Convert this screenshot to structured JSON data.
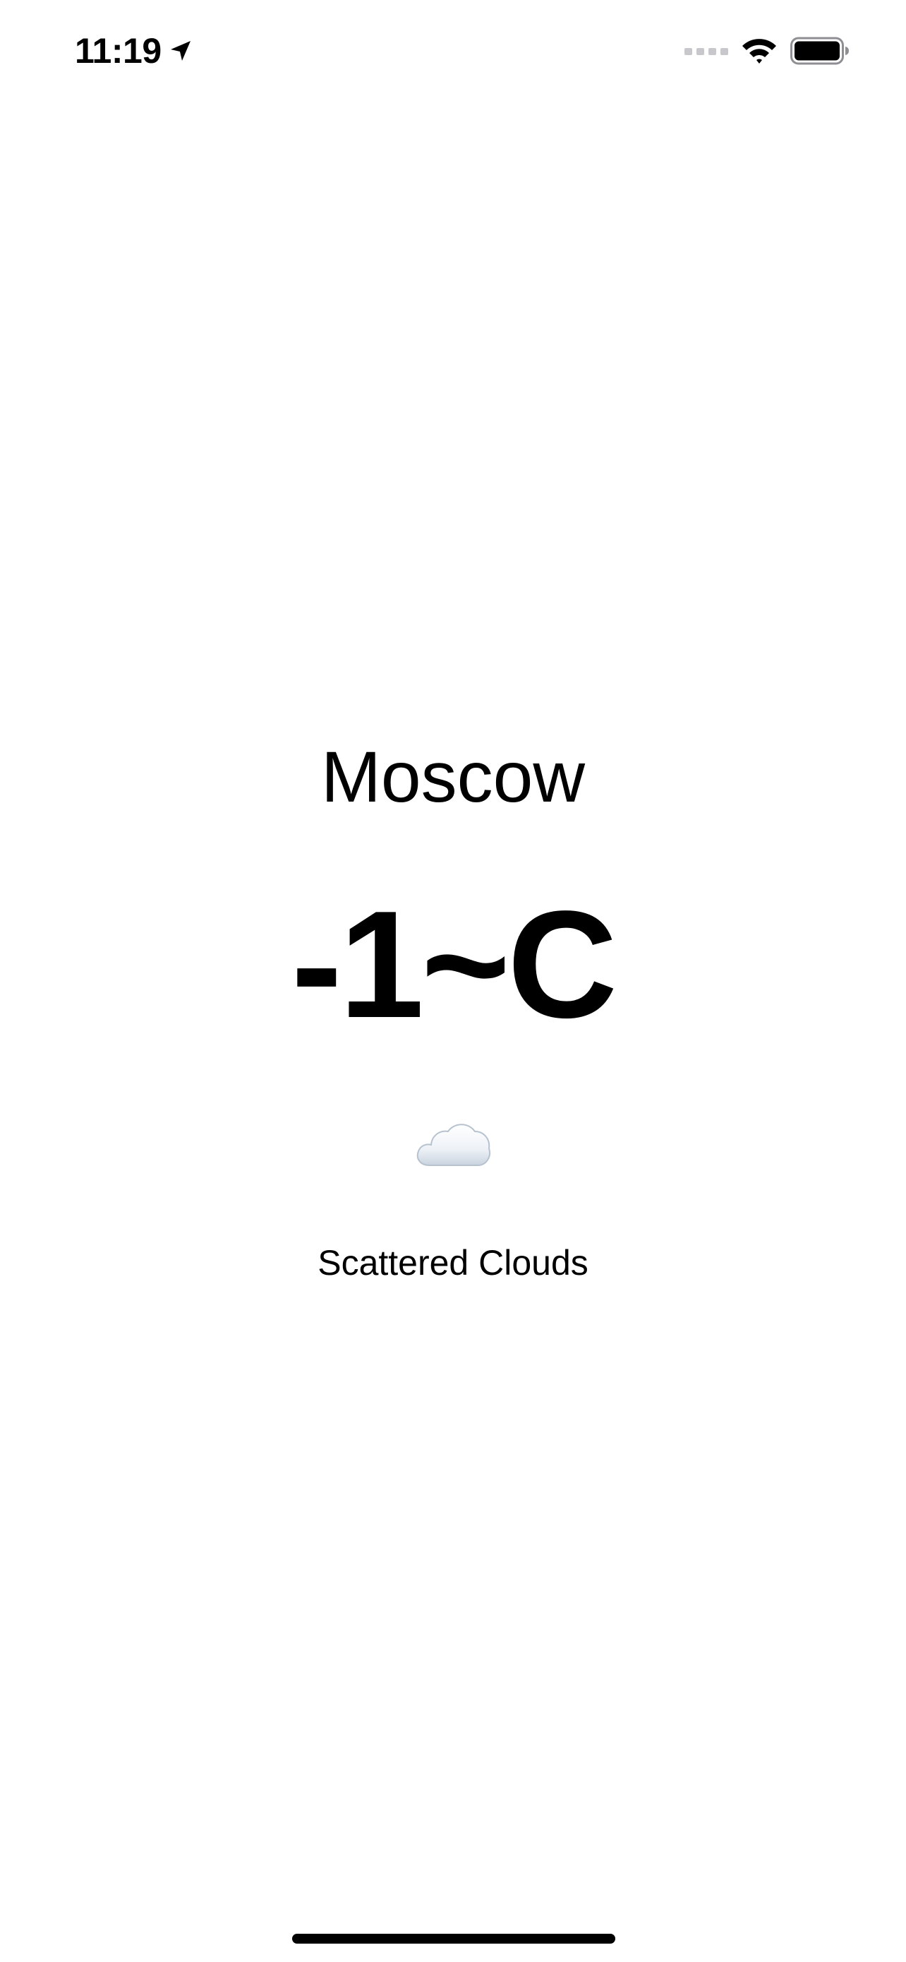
{
  "status_bar": {
    "time": "11:19",
    "icons": [
      "location-arrow-icon",
      "cellular-signal-icon",
      "wifi-icon",
      "battery-icon"
    ]
  },
  "weather": {
    "city": "Moscow",
    "temperature": "-1~C",
    "condition_icon": "cloud-icon",
    "condition": "Scattered Clouds"
  },
  "colors": {
    "background": "#ffffff",
    "text": "#000000",
    "signal_inactive": "#c7c7cc"
  }
}
